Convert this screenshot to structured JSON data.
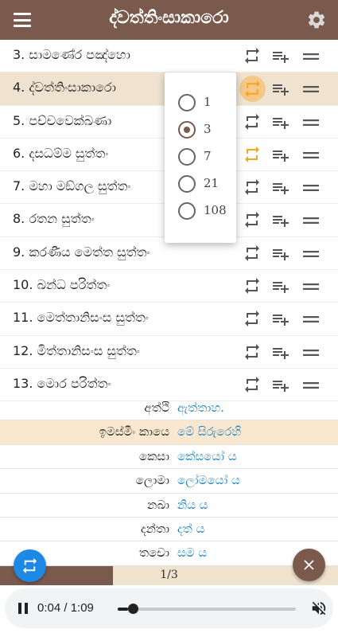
{
  "app": {
    "title": "ද්වත්තිංසාකාරො"
  },
  "sutta_list": [
    {
      "label": "3. සාමණේර පඤ්හො",
      "active": false,
      "repeat_active": false
    },
    {
      "label": "4. ද්වත්තිංසාකාරො",
      "active": true,
      "repeat_active": true
    },
    {
      "label": "5. පච්චවෙක්ඛණා",
      "active": false,
      "repeat_active": false
    },
    {
      "label": "6. දසධම්ම සුත්තං",
      "active": false,
      "repeat_active": true
    },
    {
      "label": "7. මහා මඞ්ගල සුත්තං",
      "active": false,
      "repeat_active": false
    },
    {
      "label": "8. රතන සුත්තං",
      "active": false,
      "repeat_active": false
    },
    {
      "label": "9. කරණීය මෙත්ත සුත්තං",
      "active": false,
      "repeat_active": false
    },
    {
      "label": "10. ඛන්ධ පරිත්තං",
      "active": false,
      "repeat_active": false
    },
    {
      "label": "11. මෙත්තානිසංස සුත්තං",
      "active": false,
      "repeat_active": false
    },
    {
      "label": "12. මිත්තානිසංස සුත්තං",
      "active": false,
      "repeat_active": false
    },
    {
      "label": "13. මොර පරිත්තං",
      "active": false,
      "repeat_active": false
    }
  ],
  "repeat_popup": {
    "options": [
      "1",
      "3",
      "7",
      "21",
      "108"
    ],
    "selected": "3"
  },
  "word_table": [
    {
      "pali": "අත්ථි",
      "meaning": "ඇත්තාහ.",
      "highlight": false
    },
    {
      "pali": "ඉමස්මිං කායෙ",
      "meaning": "මේ සිරුරෙහි",
      "highlight": true
    },
    {
      "pali": "කෙසා",
      "meaning": "කේසයෝ ය",
      "highlight": false
    },
    {
      "pali": "ලොමා",
      "meaning": "ලෝමයෝ ය",
      "highlight": false
    },
    {
      "pali": "නඛා",
      "meaning": "නිය ය",
      "highlight": false
    },
    {
      "pali": "දන්තා",
      "meaning": "දත් ය",
      "highlight": false
    },
    {
      "pali": "තචො",
      "meaning": "සම ය",
      "highlight": false
    }
  ],
  "pager": {
    "text": "1/3",
    "progress": 0.333
  },
  "player": {
    "time": "0:04 / 1:09",
    "current_seconds": 4,
    "total_seconds": 69
  },
  "colors": {
    "brand": "#7a5a4c",
    "accent_orange": "#f5a623",
    "link_blue": "#1a84c4",
    "fab_blue": "#1e88e5",
    "active_row": "#efe3cf"
  },
  "icons": {
    "menu": "hamburger-icon",
    "settings": "gear-icon",
    "repeat": "repeat-icon",
    "add_to_list": "playlist-add-icon",
    "reorder": "drag-handle-icon",
    "fab_left": "repeat-icon",
    "fab_right": "close-icon",
    "play_state": "pause-icon",
    "volume": "volume-mute-icon"
  }
}
